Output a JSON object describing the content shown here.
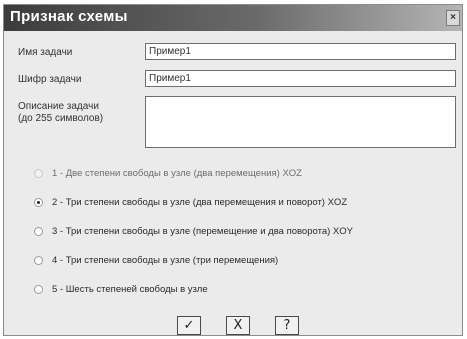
{
  "window": {
    "title": "Признак схемы",
    "close_glyph": "×"
  },
  "fields": {
    "task_name": {
      "label": "Имя задачи",
      "value": "Пример1"
    },
    "task_code": {
      "label": "Шифр задачи",
      "value": "Пример1"
    },
    "task_description": {
      "label_line1": "Описание задачи",
      "label_line2": "(до 255 символов)",
      "value": ""
    }
  },
  "schemes": [
    {
      "label": "1 - Две степени свободы в узле (два перемещения) XOZ",
      "checked": false,
      "enabled": false
    },
    {
      "label": "2 - Три степени свободы в узле (два перемещения и поворот) XOZ",
      "checked": true,
      "enabled": true
    },
    {
      "label": "3 - Три степени свободы в узле (перемещение и два поворота) XOY",
      "checked": false,
      "enabled": true
    },
    {
      "label": "4 - Три степени свободы в узле (три перемещения)",
      "checked": false,
      "enabled": true
    },
    {
      "label": "5 - Шесть степеней свободы в узле",
      "checked": false,
      "enabled": true
    }
  ],
  "buttons": {
    "ok": "✓",
    "cancel": "X",
    "help": "?"
  }
}
